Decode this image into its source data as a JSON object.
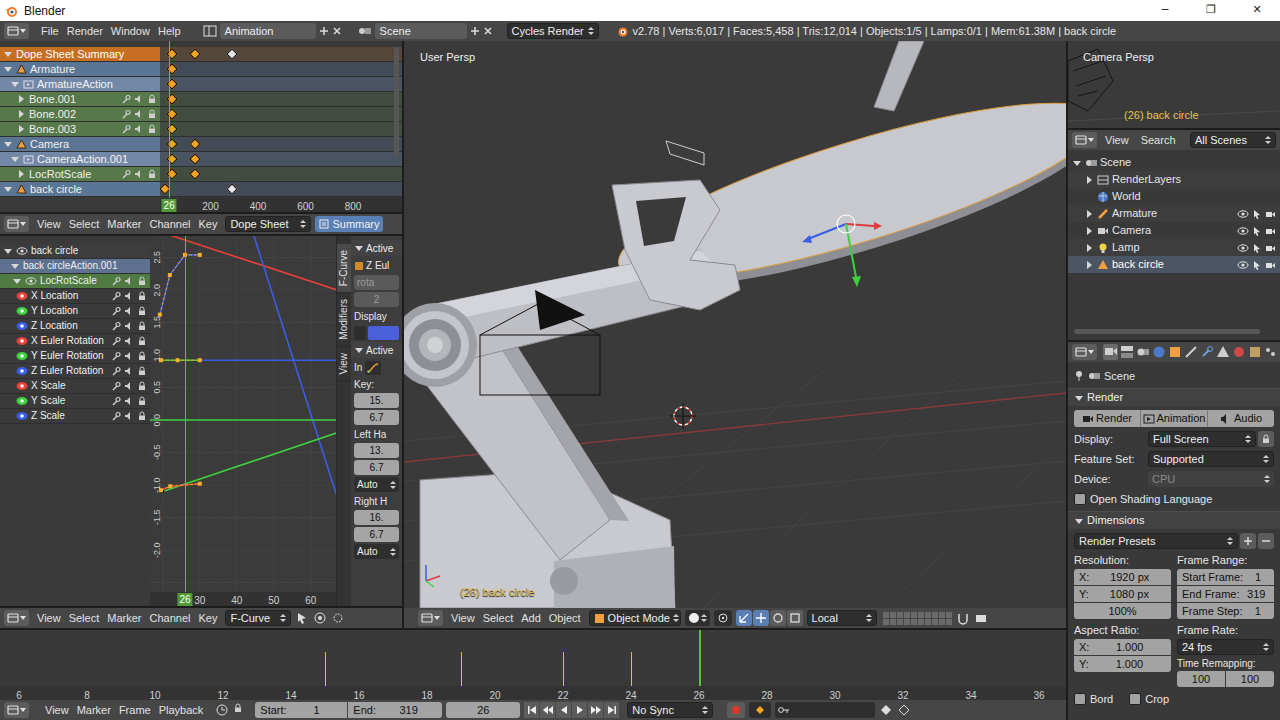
{
  "window": {
    "title": "Blender",
    "controls": [
      "─",
      "❐",
      "✕"
    ]
  },
  "info": {
    "menus": [
      "File",
      "Render",
      "Window",
      "Help"
    ],
    "layout": "Animation",
    "scene": "Scene",
    "engine": "Cycles Render",
    "stats": "v2.78 | Verts:6,017 | Faces:5,458 | Tris:12,014 | Objects:1/5 | Lamps:0/1 | Mem:61.38M | back circle"
  },
  "dopesheet": {
    "channels": [
      {
        "label": "Dope Sheet Summary",
        "kind": "summary",
        "expanded": true,
        "keys": [
          {
            "frame": 36,
            "selected": true
          },
          {
            "frame": 133,
            "selected": true
          },
          {
            "frame": 292,
            "selected": false
          }
        ]
      },
      {
        "label": "Armature",
        "kind": "object",
        "expanded": true,
        "keys": [
          {
            "frame": 36,
            "selected": true
          }
        ]
      },
      {
        "label": "ArmatureAction",
        "kind": "action",
        "expanded": true,
        "keys": [
          {
            "frame": 36,
            "selected": true
          }
        ]
      },
      {
        "label": "Bone.001",
        "kind": "group",
        "expanded": false,
        "keys": [
          {
            "frame": 36,
            "selected": true
          }
        ]
      },
      {
        "label": "Bone.002",
        "kind": "group",
        "expanded": false,
        "keys": [
          {
            "frame": 36,
            "selected": true
          }
        ]
      },
      {
        "label": "Bone.003",
        "kind": "group",
        "expanded": false,
        "keys": [
          {
            "frame": 36,
            "selected": true
          }
        ]
      },
      {
        "label": "Camera",
        "kind": "object",
        "expanded": true,
        "keys": [
          {
            "frame": 36,
            "selected": true
          },
          {
            "frame": 133,
            "selected": true
          }
        ]
      },
      {
        "label": "CameraAction.001",
        "kind": "action",
        "expanded": true,
        "keys": [
          {
            "frame": 36,
            "selected": true
          },
          {
            "frame": 133,
            "selected": true
          }
        ]
      },
      {
        "label": "LocRotScale",
        "kind": "group",
        "expanded": false,
        "keys": [
          {
            "frame": 36,
            "selected": true
          },
          {
            "frame": 133,
            "selected": true
          }
        ]
      },
      {
        "label": "back circle",
        "kind": "object",
        "expanded": true,
        "keys": [
          {
            "frame": 10,
            "selected": true
          },
          {
            "frame": 292,
            "selected": false
          }
        ]
      }
    ],
    "ruler": [
      "200",
      "400",
      "600",
      "800"
    ],
    "current_frame": 26,
    "frame_label": "26"
  },
  "dopesheet_header": {
    "menus": [
      "View",
      "Select",
      "Marker",
      "Channel",
      "Key"
    ],
    "mode": "Dope Sheet",
    "summary": "Summary",
    "summary_on": true
  },
  "graph": {
    "channels": [
      {
        "label": "back circle",
        "kind": "object",
        "expanded": true
      },
      {
        "label": "back circleAction.001",
        "kind": "action",
        "expanded": true
      },
      {
        "label": "LocRotScale",
        "kind": "group",
        "expanded": true
      },
      {
        "label": "X Location",
        "kind": "fcurve",
        "color": "#e8403a"
      },
      {
        "label": "Y Location",
        "kind": "fcurve",
        "color": "#3ed13e"
      },
      {
        "label": "Z Location",
        "kind": "fcurve",
        "color": "#3a5de8"
      },
      {
        "label": "X Euler Rotation",
        "kind": "fcurve",
        "color": "#e8403a"
      },
      {
        "label": "Y Euler Rotation",
        "kind": "fcurve",
        "color": "#3ed13e"
      },
      {
        "label": "Z Euler Rotation",
        "kind": "fcurve",
        "color": "#3a5de8"
      },
      {
        "label": "X Scale",
        "kind": "fcurve",
        "color": "#e8403a"
      },
      {
        "label": "Y Scale",
        "kind": "fcurve",
        "color": "#3ed13e"
      },
      {
        "label": "Z Scale",
        "kind": "fcurve",
        "color": "#3a5de8"
      }
    ],
    "y_labels": [
      "2.5",
      "2.0",
      "1.5",
      "1.0",
      "0.5",
      "0.0",
      "-0.5",
      "-1.0",
      "-1.5",
      "-2.0"
    ],
    "x_labels": [
      "30",
      "40",
      "50",
      "60"
    ],
    "current_frame": 26,
    "frame_label": "26",
    "curves": [
      {
        "color": "#e8403a",
        "selected": false,
        "points": [
          [
            20,
            2.88
          ],
          [
            80,
            1.76
          ]
        ]
      },
      {
        "color": "#3a5de8",
        "selected": false,
        "points": [
          [
            40,
            3.66
          ],
          [
            70,
            -1.7
          ]
        ]
      },
      {
        "color": "#3a5de8",
        "selected": false,
        "points": [
          [
            30,
            0.92
          ],
          [
            80,
            0.92
          ]
        ]
      },
      {
        "color": "#3ed13e",
        "selected": false,
        "points": [
          [
            0,
            0
          ],
          [
            80,
            0
          ]
        ]
      },
      {
        "color": "#3ed13e",
        "selected": false,
        "points": [
          [
            20,
            -1.1
          ],
          [
            80,
            0.05
          ]
        ]
      },
      {
        "color": "#3a5de8",
        "selected": true,
        "points": [
          [
            19.2,
            1.62
          ],
          [
            21.9,
            2.23
          ],
          [
            26,
            2.54
          ],
          [
            30,
            2.54
          ]
        ]
      },
      {
        "color": "#3ed13e",
        "selected": true,
        "points": [
          [
            19.5,
            0.92
          ],
          [
            24,
            0.92
          ],
          [
            30,
            0.92
          ]
        ]
      },
      {
        "color": "#e8403a",
        "selected": true,
        "points": [
          [
            19.5,
            -1.08
          ],
          [
            22,
            -1.02
          ],
          [
            30,
            -0.98
          ]
        ]
      }
    ]
  },
  "graph_sidebar": {
    "tabs": [
      {
        "label": "F-Curve",
        "selected": true
      },
      {
        "label": "Modifiers",
        "selected": false
      },
      {
        "label": "View",
        "selected": false
      }
    ],
    "active_panel": {
      "title": "Active",
      "expanded": true,
      "channel": "Z Eul",
      "path": "rota",
      "index": "2",
      "disabled": true,
      "display_label": "Display",
      "display_color": "#4b5fd8"
    },
    "key_panel": {
      "title": "Active",
      "expanded": true,
      "interp_label": "In",
      "key_label": "Key:",
      "key_frame": "15.",
      "key_value": "6.7",
      "left_label": "Left Ha",
      "left_frame": "13.",
      "left_value": "6.7",
      "left_type": "Auto",
      "right_label": "Right H",
      "right_frame": "16.",
      "right_value": "6.7",
      "right_type": "Auto"
    }
  },
  "graph_header": {
    "menus": [
      "View",
      "Select",
      "Marker",
      "Channel",
      "Key"
    ],
    "mode": "F-Curve"
  },
  "viewport": {
    "view": "User Persp",
    "object": "(26) back circle",
    "menus": [
      "View",
      "Select",
      "Add",
      "Object"
    ],
    "mode": "Object Mode",
    "orientation": "Local"
  },
  "camera_view": {
    "view": "Camera Persp",
    "object": "(26) back circle"
  },
  "outliner": {
    "menus": [
      "View",
      "Search"
    ],
    "filter": "All Scenes",
    "items": [
      {
        "label": "Scene",
        "depth": 0,
        "kind": "scene",
        "expanded": true,
        "selected": false
      },
      {
        "label": "RenderLayers",
        "depth": 1,
        "kind": "renderlayers",
        "expanded": false,
        "selected": false
      },
      {
        "label": "World",
        "depth": 1,
        "kind": "world",
        "expanded": false,
        "selected": false
      },
      {
        "label": "Armature",
        "depth": 1,
        "kind": "armature",
        "expanded": false,
        "selected": false
      },
      {
        "label": "Camera",
        "depth": 1,
        "kind": "camera",
        "expanded": false,
        "selected": false
      },
      {
        "label": "Lamp",
        "depth": 1,
        "kind": "lamp",
        "expanded": false,
        "selected": false
      },
      {
        "label": "back circle",
        "depth": 1,
        "kind": "mesh",
        "expanded": false,
        "selected": true
      }
    ]
  },
  "properties": {
    "context": "Scene",
    "render": {
      "title": "Render",
      "expanded": true,
      "buttons": [
        "Render",
        "Animation",
        "Audio"
      ],
      "display_label": "Display:",
      "display": "Full Screen",
      "feature_label": "Feature Set:",
      "feature": "Supported",
      "device_label": "Device:",
      "device": "CPU",
      "device_disabled": true,
      "osl": "Open Shading Language",
      "osl_checked": false
    },
    "dimensions": {
      "title": "Dimensions",
      "expanded": true,
      "presets": "Render Presets",
      "resolution_label": "Resolution:",
      "res_x_label": "X:",
      "res_x": "1920 px",
      "res_y_label": "Y:",
      "res_y": "1080 px",
      "res_pct": "100%",
      "range_label": "Frame Range:",
      "start_label": "Start Frame:",
      "start": "1",
      "end_label": "End Frame:",
      "end": "319",
      "step_label": "Frame Step:",
      "step": "1",
      "aspect_label": "Aspect Ratio:",
      "aspect_x_label": "X:",
      "aspect_x": "1.000",
      "aspect_y_label": "Y:",
      "aspect_y": "1.000",
      "rate_label": "Frame Rate:",
      "rate": "24 fps",
      "remap_label": "Time Remapping:",
      "remap_old": "100",
      "remap_new": "100",
      "border": "Bord",
      "border_checked": false,
      "crop": "Crop",
      "crop_checked": false
    }
  },
  "timeline": {
    "ruler": [
      "6",
      "8",
      "10",
      "12",
      "14",
      "16",
      "18",
      "20",
      "22",
      "24",
      "26",
      "28",
      "30",
      "32",
      "34",
      "36"
    ],
    "keys": [
      15,
      19,
      22,
      24
    ],
    "current_frame": 26,
    "menus": [
      "View",
      "Marker",
      "Frame",
      "Playback"
    ],
    "start_label": "Start:",
    "start": "1",
    "end_label": "End:",
    "end": "319",
    "current": "26",
    "sync": "No Sync"
  }
}
